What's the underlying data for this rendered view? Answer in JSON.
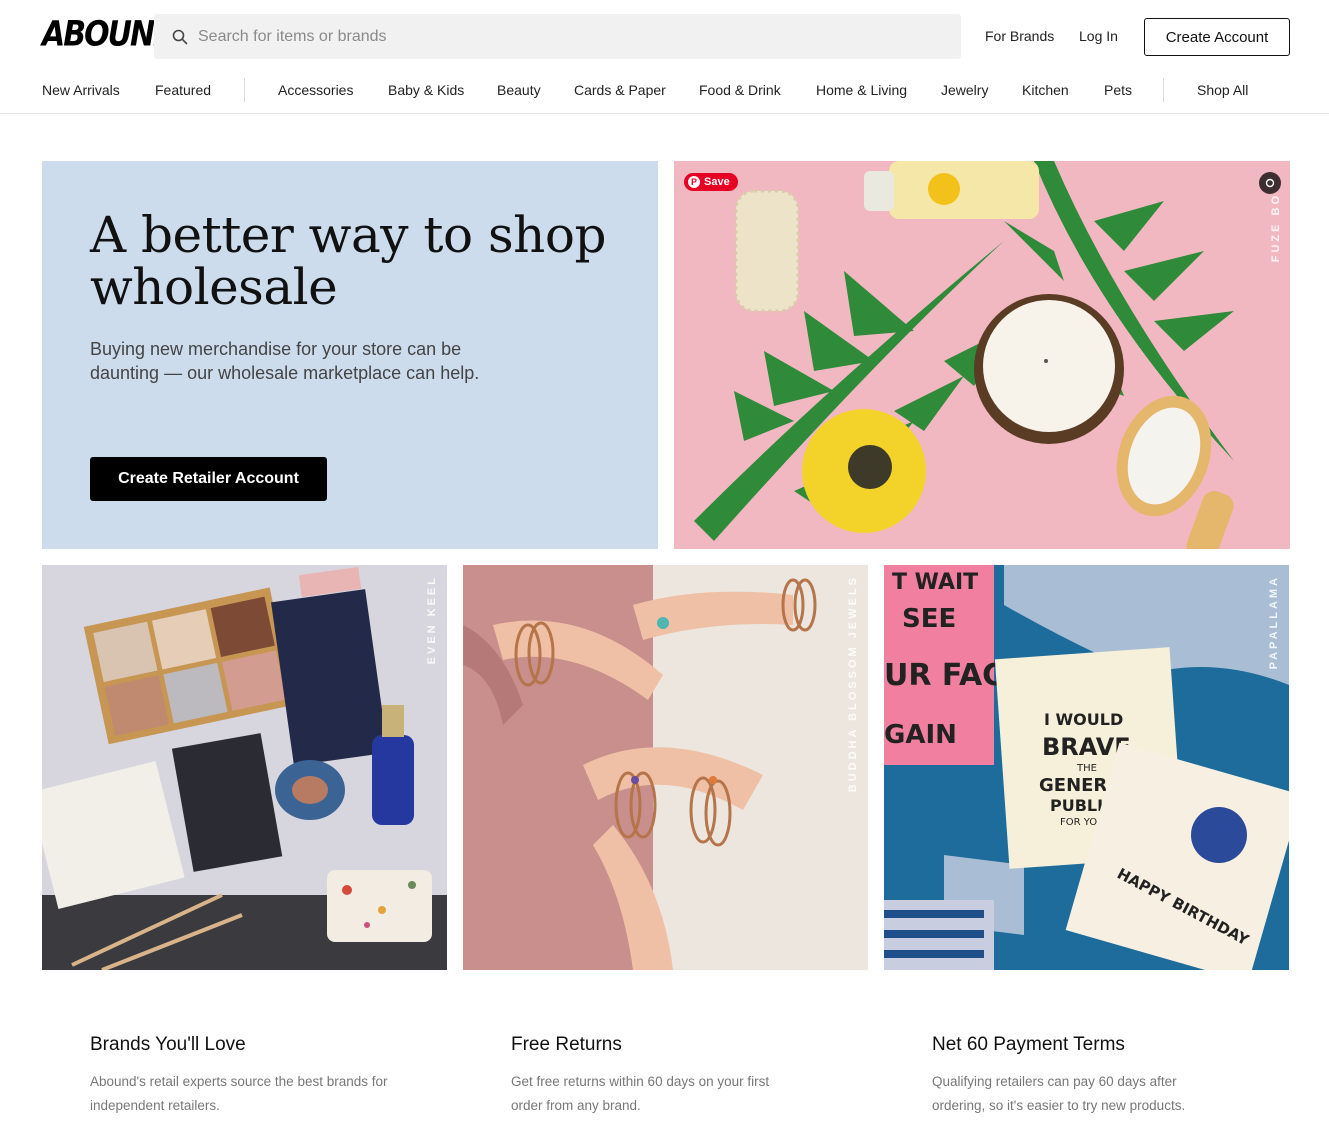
{
  "header": {
    "logo": "ABOUND",
    "search_placeholder": "Search for items or brands",
    "for_brands": "For Brands",
    "log_in": "Log In",
    "create_account": "Create Account"
  },
  "nav": {
    "items": [
      "New Arrivals",
      "Featured",
      "Accessories",
      "Baby & Kids",
      "Beauty",
      "Cards & Paper",
      "Food & Drink",
      "Home & Living",
      "Jewelry",
      "Kitchen",
      "Pets",
      "Shop All"
    ]
  },
  "hero": {
    "title": "A better way to shop wholesale",
    "subtitle": "Buying new merchandise for your store can be daunting — our wholesale marketplace can help.",
    "cta": "Create Retailer Account"
  },
  "tiles": {
    "tile1": {
      "brand_label": "FUZE BO",
      "save_label": "Save"
    },
    "tile2": {
      "brand_label": "EVEN KEEL"
    },
    "tile3": {
      "brand_label": "BUDDHA BLOSSOM JEWELS"
    },
    "tile4": {
      "brand_label": "PAPALLAMA",
      "card_text_1": "I WOULD",
      "card_text_2": "BRAVE",
      "card_text_3": "THE",
      "card_text_4": "GENERAL",
      "card_text_5": "PUBLIC",
      "card_text_6": "FOR YOU",
      "card2_text": "HAPPY BIRTHDAY",
      "card3_text": "T WAIT SEE UR FACE GAIN"
    }
  },
  "features": [
    {
      "title": "Brands You'll Love",
      "text": "Abound's retail experts source the best brands for independent retailers."
    },
    {
      "title": "Free Returns",
      "text": "Get free returns within 60 days on your first order from any brand."
    },
    {
      "title": "Net 60 Payment Terms",
      "text": "Qualifying retailers can pay 60 days after ordering, so it's easier to try new products."
    }
  ],
  "colors": {
    "hero_bg": "#cddced",
    "pin_red": "#e60023",
    "tile1_bg": "#f2b8c1",
    "tile4_bg": "#1d6c9b"
  }
}
